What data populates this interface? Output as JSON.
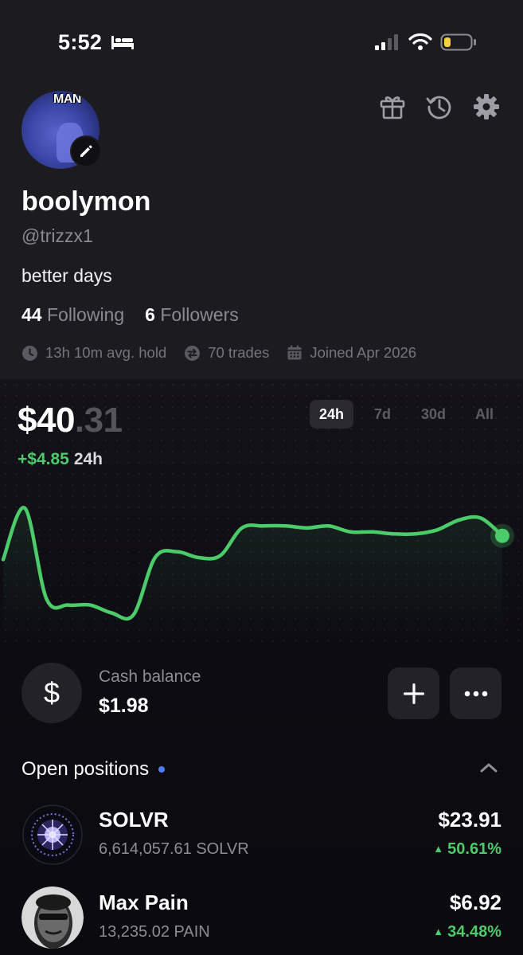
{
  "status_bar": {
    "time": "5:52"
  },
  "profile": {
    "avatar_text": "MAN",
    "name": "boolymon",
    "handle": "@trizzx1",
    "bio": "better days",
    "following_count": "44",
    "following_label": "Following",
    "followers_count": "6",
    "followers_label": "Followers",
    "avg_hold": "13h 10m avg. hold",
    "trades": "70 trades",
    "joined": "Joined Apr 2026"
  },
  "portfolio": {
    "value_main": "$40",
    "value_cents": ".31",
    "change": "+$4.85",
    "change_period": "24h",
    "ranges": [
      "24h",
      "7d",
      "30d",
      "All"
    ],
    "active_range": "24h",
    "accent_color": "#4ccb6b"
  },
  "chart_data": {
    "type": "line",
    "title": "",
    "xlabel": "",
    "ylabel": "",
    "series": [
      {
        "values": [
          37.2,
          39.8,
          35.2,
          34.9,
          34.9,
          34.5,
          34.4,
          37.3,
          37.6,
          37.3,
          37.4,
          38.8,
          38.9,
          38.9,
          38.8,
          38.9,
          38.6,
          38.6,
          38.5,
          38.5,
          38.7,
          39.2,
          39.3,
          38.4
        ]
      }
    ],
    "grid": false,
    "color": "#4ccb6b"
  },
  "cash": {
    "icon_symbol": "$",
    "label": "Cash balance",
    "value": "$1.98"
  },
  "positions_section": {
    "title": "Open positions"
  },
  "positions": [
    {
      "name": "SOLVR",
      "quantity": "6,614,057.61 SOLVR",
      "value": "$23.91",
      "change": "50.61%"
    },
    {
      "name": "Max Pain",
      "quantity": "13,235.02 PAIN",
      "value": "$6.92",
      "change": "34.48%"
    }
  ]
}
